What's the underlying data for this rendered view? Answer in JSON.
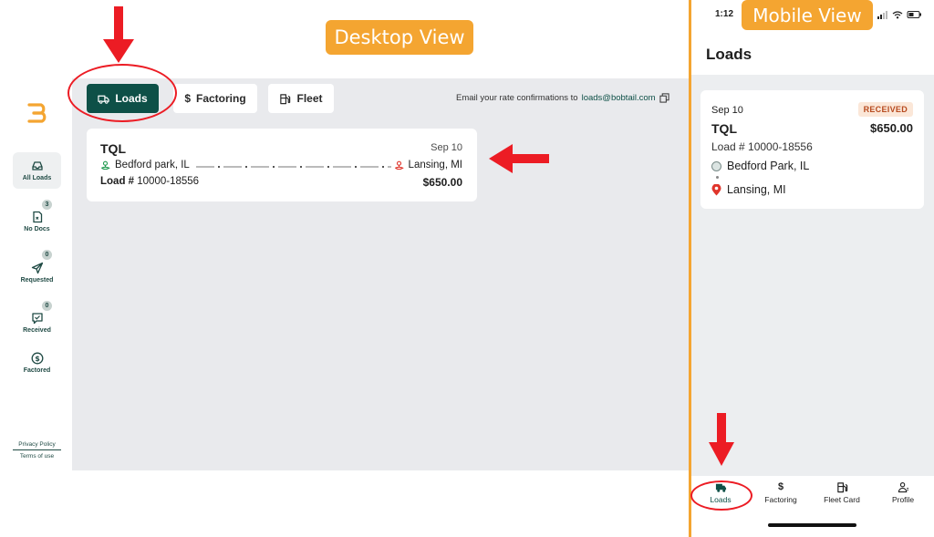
{
  "labels": {
    "desktop": "Desktop View",
    "mobile": "Mobile View"
  },
  "colors": {
    "brand_green": "#0e5047",
    "annotation_orange": "#f4a531",
    "annotation_red": "#ec1c24"
  },
  "desktop": {
    "sidebar": {
      "items": [
        {
          "label": "All Loads",
          "icon": "inbox-icon"
        },
        {
          "label": "No Docs",
          "badge": "3",
          "icon": "document-icon"
        },
        {
          "label": "Requested",
          "badge": "0",
          "icon": "send-icon"
        },
        {
          "label": "Received",
          "badge": "0",
          "icon": "message-check-icon"
        },
        {
          "label": "Factored",
          "icon": "dollar-circle-icon"
        }
      ],
      "privacy": "Privacy Policy",
      "terms": "Terms of use"
    },
    "tabs": [
      {
        "label": "Loads",
        "icon": "truck-icon"
      },
      {
        "label": "Factoring",
        "icon": "dollar-icon"
      },
      {
        "label": "Fleet",
        "icon": "fuel-icon"
      }
    ],
    "email_prefix": "Email your rate confirmations to",
    "email": "loads@bobtail.com",
    "load": {
      "company": "TQL",
      "date": "Sep 10",
      "origin": "Bedford park, IL",
      "destination": "Lansing, MI",
      "load_label": "Load #",
      "load_number": "10000-18556",
      "amount": "$650.00"
    }
  },
  "mobile": {
    "time": "1:12",
    "title": "Loads",
    "load": {
      "date": "Sep 10",
      "status": "RECEIVED",
      "company": "TQL",
      "amount": "$650.00",
      "load_number": "Load # 10000-18556",
      "origin": "Bedford Park, IL",
      "destination": "Lansing, MI"
    },
    "tabs": [
      {
        "label": "Loads",
        "icon": "truck-icon"
      },
      {
        "label": "Factoring",
        "icon": "dollar-icon"
      },
      {
        "label": "Fleet Card",
        "icon": "fuel-icon"
      },
      {
        "label": "Profile",
        "icon": "profile-icon"
      }
    ]
  }
}
